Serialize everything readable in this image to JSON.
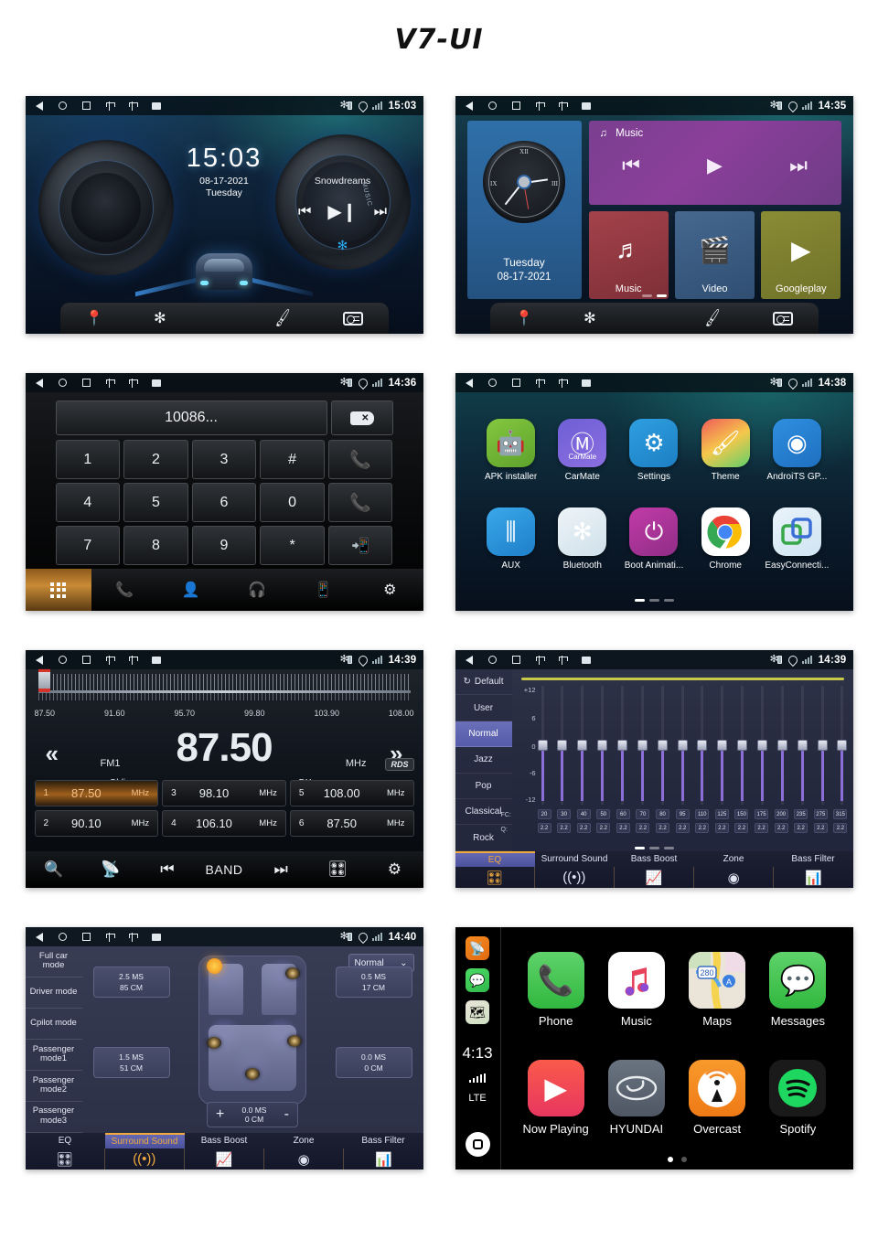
{
  "title": "V7-UI",
  "statusbar": {
    "nav_icons": [
      "back-icon",
      "home-icon",
      "recents-icon",
      "usb-icon",
      "usb-icon",
      "sd-card-icon"
    ],
    "right_icons": [
      "bluetooth-battery-icon",
      "location-icon",
      "signal-icon"
    ]
  },
  "panels": {
    "home": {
      "time": "15:03",
      "clock_time": "15:03",
      "date": "08-17-2021",
      "weekday": "Tuesday",
      "track": "Snowdreams",
      "music_label": "MUSIC",
      "dock": [
        "navigation-icon",
        "bluetooth-icon",
        "apps-icon",
        "theme-icon",
        "radio-icon"
      ]
    },
    "widgets": {
      "time": "14:35",
      "weekday": "Tuesday",
      "date": "08-17-2021",
      "clock_numerals": {
        "twelve": "XII",
        "three": "III",
        "nine": "IX"
      },
      "music_widget_title": "Music",
      "tiles": [
        {
          "label": "Music",
          "icon": "music-note-icon"
        },
        {
          "label": "Video",
          "icon": "video-clapper-icon"
        },
        {
          "label": "Googleplay",
          "icon": "google-play-icon"
        }
      ]
    },
    "phone": {
      "time": "14:36",
      "number": "10086...",
      "keys": [
        "1",
        "2",
        "3",
        "#",
        "4",
        "5",
        "6",
        "0",
        "7",
        "8",
        "9",
        "*"
      ],
      "call_icon": "call-answer-icon",
      "hangup_icon": "call-end-icon",
      "transfer_icon": "call-transfer-icon",
      "delete_icon": "backspace-icon",
      "nav": [
        "dialpad-icon",
        "call-log-icon",
        "contacts-icon",
        "bt-headset-icon",
        "bt-device-icon",
        "settings-icon"
      ]
    },
    "apps": {
      "time": "14:38",
      "items": [
        {
          "label": "APK installer",
          "icon": "android-icon"
        },
        {
          "label": "CarMate",
          "icon": "carmate-icon",
          "badge": "CarMate"
        },
        {
          "label": "Settings",
          "icon": "car-settings-icon"
        },
        {
          "label": "Theme",
          "icon": "paint-brush-icon"
        },
        {
          "label": "AndroiTS GP...",
          "icon": "gps-radar-icon"
        },
        {
          "label": "AUX",
          "icon": "aux-jack-icon"
        },
        {
          "label": "Bluetooth",
          "icon": "bluetooth-icon"
        },
        {
          "label": "Boot Animati...",
          "icon": "power-icon"
        },
        {
          "label": "Chrome",
          "icon": "chrome-icon"
        },
        {
          "label": "EasyConnecti...",
          "icon": "easyconnection-icon"
        }
      ]
    },
    "radio": {
      "time": "14:39",
      "scale_labels": [
        "87.50",
        "91.60",
        "95.70",
        "99.80",
        "103.90",
        "108.00"
      ],
      "frequency": "87.50",
      "unit": "MHz",
      "band": "FM1",
      "genre": "Oldies",
      "mode": "DX",
      "rds": "RDS",
      "prev_icon": "rewind-icon",
      "next_icon": "fast-forward-icon",
      "presets": [
        {
          "n": "1",
          "freq": "87.50",
          "unit": "MHz",
          "active": true
        },
        {
          "n": "2",
          "freq": "90.10",
          "unit": "MHz",
          "active": false
        },
        {
          "n": "3",
          "freq": "98.10",
          "unit": "MHz",
          "active": false
        },
        {
          "n": "4",
          "freq": "106.10",
          "unit": "MHz",
          "active": false
        },
        {
          "n": "5",
          "freq": "108.00",
          "unit": "MHz",
          "active": false
        },
        {
          "n": "6",
          "freq": "87.50",
          "unit": "MHz",
          "active": false
        }
      ],
      "nav_band_label": "BAND",
      "nav": [
        "search-icon",
        "scan-icon",
        "prev-track-icon",
        "band-label",
        "next-track-icon",
        "equalizer-icon",
        "settings-icon"
      ]
    },
    "eq": {
      "time": "14:39",
      "presets": [
        "Default",
        "User",
        "Normal",
        "Jazz",
        "Pop",
        "Classical",
        "Rock"
      ],
      "active_preset": "Normal",
      "y_labels": [
        "+12",
        "6",
        "0",
        "-6",
        "-12"
      ],
      "fc_label": "FC:",
      "q_label": "Q:",
      "fc_values": [
        "20",
        "30",
        "40",
        "50",
        "60",
        "70",
        "80",
        "95",
        "110",
        "125",
        "150",
        "175",
        "200",
        "235",
        "275",
        "315"
      ],
      "q_values": [
        "2.2",
        "2.2",
        "2.2",
        "2.2",
        "2.2",
        "2.2",
        "2.2",
        "2.2",
        "2.2",
        "2.2",
        "2.2",
        "2.2",
        "2.2",
        "2.2",
        "2.2",
        "2.2"
      ],
      "band_values": [
        0,
        0,
        0,
        0,
        0,
        0,
        0,
        0,
        0,
        0,
        0,
        0,
        0,
        0,
        0,
        0
      ],
      "tabs": [
        {
          "label": "EQ",
          "icon": "equalizer-icon",
          "active": true
        },
        {
          "label": "Surround Sound",
          "icon": "surround-icon",
          "active": false
        },
        {
          "label": "Bass Boost",
          "icon": "bass-boost-icon",
          "active": false
        },
        {
          "label": "Zone",
          "icon": "zone-icon",
          "active": false
        },
        {
          "label": "Bass Filter",
          "icon": "bass-filter-icon",
          "active": false
        }
      ]
    },
    "surround": {
      "time": "14:40",
      "modes": [
        "Full car mode",
        "Driver mode",
        "Cpilot mode",
        "Passenger mode1",
        "Passenger mode2",
        "Passenger mode3"
      ],
      "selector": "Normal",
      "delays": [
        {
          "ms": "2.5 MS",
          "cm": "85 CM",
          "pos": "front-left"
        },
        {
          "ms": "0.5 MS",
          "cm": "17 CM",
          "pos": "front-right"
        },
        {
          "ms": "1.5 MS",
          "cm": "51 CM",
          "pos": "rear-left"
        },
        {
          "ms": "0.0 MS",
          "cm": "0 CM",
          "pos": "rear-right"
        }
      ],
      "stepper": {
        "ms": "0.0 MS",
        "cm": "0 CM",
        "plus": "+",
        "minus": "-"
      },
      "tabs": [
        {
          "label": "EQ",
          "icon": "equalizer-icon",
          "active": false
        },
        {
          "label": "Surround Sound",
          "icon": "surround-icon",
          "active": true
        },
        {
          "label": "Bass Boost",
          "icon": "bass-boost-icon",
          "active": false
        },
        {
          "label": "Zone",
          "icon": "zone-icon",
          "active": false
        },
        {
          "label": "Bass Filter",
          "icon": "bass-filter-icon",
          "active": false
        }
      ]
    },
    "carplay": {
      "time": "4:13",
      "network": "LTE",
      "sidebar_icons": [
        "overcast-icon",
        "messages-icon",
        "maps-icon",
        "home-button-icon"
      ],
      "apps": [
        {
          "label": "Phone",
          "icon": "phone-icon"
        },
        {
          "label": "Music",
          "icon": "apple-music-icon"
        },
        {
          "label": "Maps",
          "icon": "apple-maps-icon",
          "shield": "280"
        },
        {
          "label": "Messages",
          "icon": "messages-icon"
        },
        {
          "label": "Now Playing",
          "icon": "now-playing-icon"
        },
        {
          "label": "HYUNDAI",
          "icon": "hyundai-icon"
        },
        {
          "label": "Overcast",
          "icon": "overcast-icon"
        },
        {
          "label": "Spotify",
          "icon": "spotify-icon"
        }
      ]
    }
  }
}
